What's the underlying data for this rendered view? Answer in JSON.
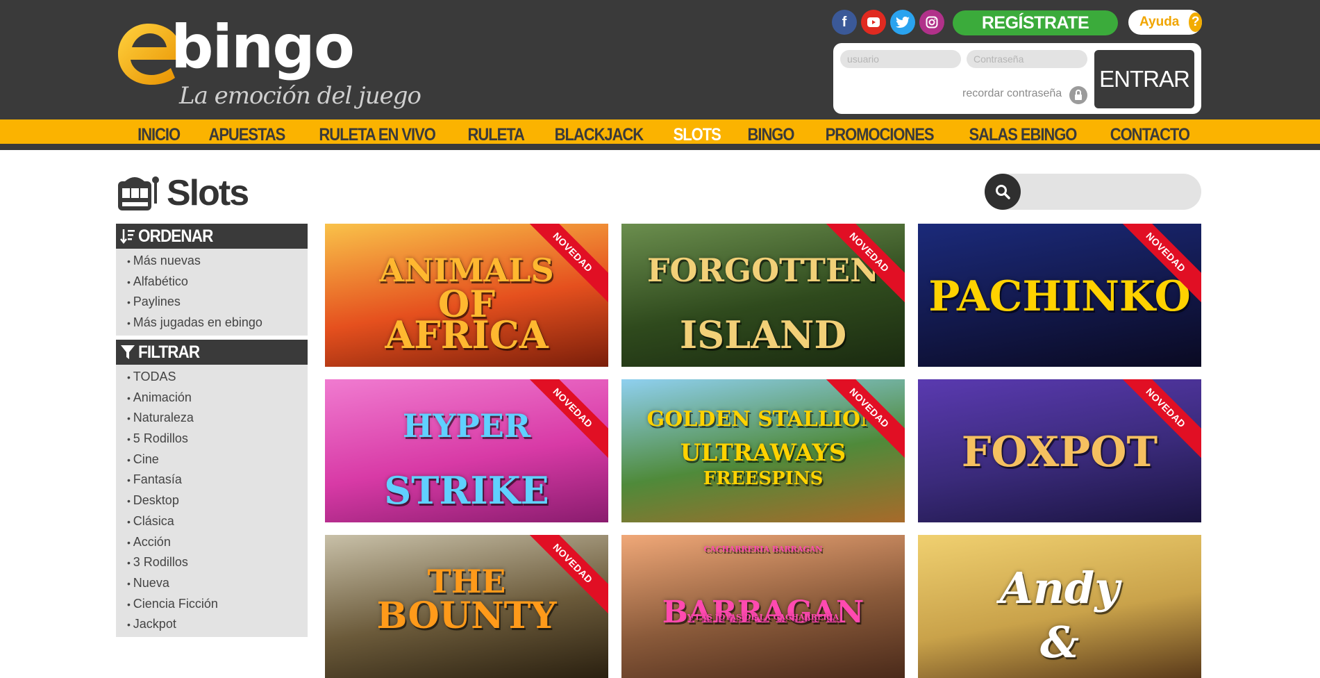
{
  "brand": {
    "name": "bingo",
    "tagline": "La emoción del juego"
  },
  "header": {
    "social": [
      "facebook-icon",
      "youtube-icon",
      "twitter-icon",
      "instagram-icon"
    ],
    "register_label": "REGÍSTRATE",
    "help_label": "Ayuda",
    "help_icon": "?",
    "login": {
      "user_placeholder": "usuario",
      "password_placeholder": "Contraseña",
      "remember_label": "recordar contraseña",
      "submit_label": "ENTRAR"
    }
  },
  "nav": {
    "items": [
      "INICIO",
      "APUESTAS",
      "RULETA EN VIVO",
      "RULETA",
      "BLACKJACK",
      "SLOTS",
      "BINGO",
      "PROMOCIONES",
      "SALAS EBINGO",
      "CONTACTO"
    ],
    "active": "SLOTS"
  },
  "page": {
    "title": "Slots"
  },
  "search": {
    "placeholder": ""
  },
  "sidebar": {
    "order_title": "ORDENAR",
    "order_items": [
      "Más nuevas",
      "Alfabético",
      "Paylines",
      "Más jugadas en ebingo"
    ],
    "filter_title": "FILTRAR",
    "filter_items": [
      "TODAS",
      "Animación",
      "Naturaleza",
      "5 Rodillos",
      "Cine",
      "Fantasía",
      "Desktop",
      "Clásica",
      "Acción",
      "3 Rodillos",
      "Nueva",
      "Ciencia Ficción",
      "Jackpot"
    ]
  },
  "games": [
    {
      "title": "Animals of Africa",
      "line1": "ANIMALS",
      "line2": "OF",
      "line3": "AFRICA",
      "badge": "NOVEDAD",
      "bg": "#e9521e"
    },
    {
      "title": "Forgotten Island",
      "line1": "FORGOTTEN",
      "line2": "",
      "line3": "ISLAND",
      "badge": "NOVEDAD",
      "bg": "#2f4a1d"
    },
    {
      "title": "Pachinko",
      "line1": "",
      "line2": "PACHINKO",
      "line3": "",
      "badge": "NOVEDAD",
      "bg": "#1a2260"
    },
    {
      "title": "Hyper Strike",
      "line1": "HYPER",
      "line2": "",
      "line3": "STRIKE",
      "badge": "NOVEDAD",
      "bg": "#d83aa6"
    },
    {
      "title": "Golden Stallion Ultraways Freespins",
      "line1": "GOLDEN STALLION",
      "line2": "ULTRAWAYS",
      "line3": "FREESPINS",
      "badge": "NOVEDAD",
      "bg": "#4f8a3a"
    },
    {
      "title": "Foxpot",
      "line1": "",
      "line2": "FOXPOT",
      "line3": "",
      "badge": "NOVEDAD",
      "bg": "#3a2a7a"
    },
    {
      "title": "The Bounty",
      "line1": "THE",
      "line2": "BOUNTY",
      "line3": "",
      "badge": "NOVEDAD",
      "bg": "#6b5a3a"
    },
    {
      "title": "Barragan",
      "line1": "CACHARRERIA BARRAGAN",
      "line2": "BARRAGAN",
      "line3": "Y LAS JOYAS DE LA CACHARRERIA",
      "badge": "",
      "bg": "#8a5a3a"
    },
    {
      "title": "Andy & Lucas",
      "line1": "Andy",
      "line2": "&",
      "line3": "",
      "badge": "",
      "bg": "#c9a24a"
    }
  ]
}
